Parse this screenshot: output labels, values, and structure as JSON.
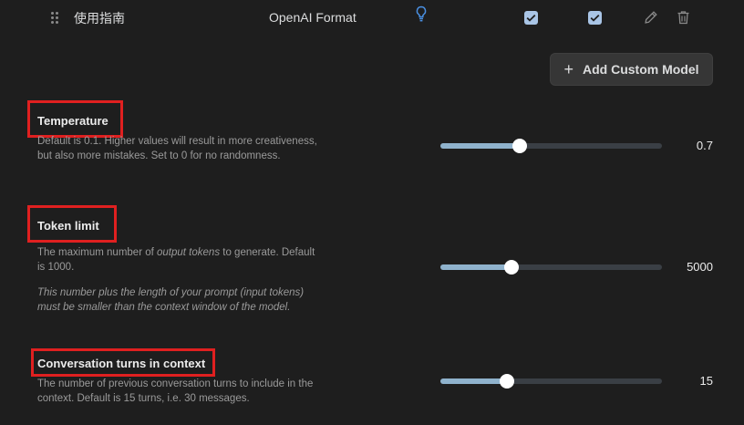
{
  "model_row": {
    "name": "使用指南",
    "format": "OpenAI Format",
    "enabled_checked": true,
    "vision_checked": true
  },
  "add_model_button": {
    "label": "Add Custom Model",
    "icon": "plus-icon"
  },
  "settings": [
    {
      "title": "Temperature",
      "description": "Default is 0.1. Higher values will result in more creativeness, but also more mistakes. Set to 0 for no randomness.",
      "value": "0.7",
      "fill_fraction": 0.36
    },
    {
      "title": "Token limit",
      "description_pre": "The maximum number of ",
      "description_em": "output tokens",
      "description_post": " to generate. Default is 1000.",
      "note": "This number plus the length of your prompt (input tokens) must be smaller than the context window of the model.",
      "value": "5000",
      "fill_fraction": 0.32
    },
    {
      "title": "Conversation turns in context",
      "description": "The number of previous conversation turns to include in the context. Default is 15 turns, i.e. 30 messages.",
      "value": "15",
      "fill_fraction": 0.3
    }
  ],
  "colors": {
    "background": "#1e1e1e",
    "slider_fill": "#8fb2cc",
    "checkbox": "#a9c5e6",
    "highlight_box": "#e02020",
    "bulb": "#4a90e2"
  }
}
